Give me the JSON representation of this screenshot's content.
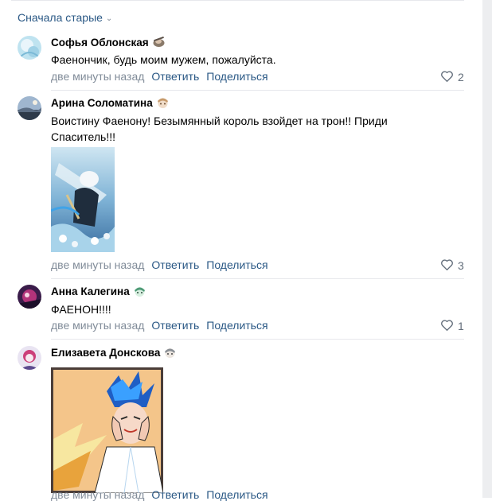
{
  "sort": {
    "label": "Сначала старые"
  },
  "comments": [
    {
      "author": "Софья Облонская",
      "text": "Фаенончик, будь моим мужем, пожалуйста.",
      "time": "две минуты назад",
      "reply": "Ответить",
      "share": "Поделиться",
      "likes": "2"
    },
    {
      "author": "Арина Соломатина",
      "text": "Воистину Фаенону! Безымянный король взойдет на трон!! Приди Спаситель!!!",
      "time": "две минуты назад",
      "reply": "Ответить",
      "share": "Поделиться",
      "likes": "3"
    },
    {
      "author": "Анна Калегина",
      "text": "ФАЕНОН!!!!",
      "time": "две минуты назад",
      "reply": "Ответить",
      "share": "Поделиться",
      "likes": "1"
    },
    {
      "author": "Елизавета Донскова",
      "time": "две минуты назад",
      "reply": "Ответить",
      "share": "Поделиться"
    }
  ],
  "colors": {
    "link": "#2a5885",
    "muted": "#818c99",
    "separator": "#e7e8ec"
  }
}
